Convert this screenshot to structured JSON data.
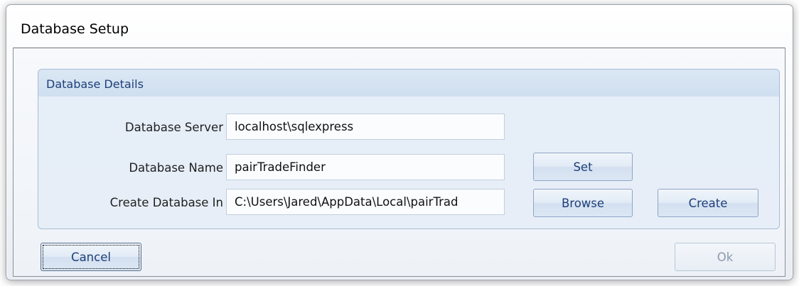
{
  "window": {
    "title": "Database Setup"
  },
  "details": {
    "group_title": "Database Details",
    "server_label": "Database Server",
    "server_value": "localhost\\sqlexpress",
    "name_label": "Database Name",
    "name_value": "pairTradeFinder",
    "location_label": "Create Database In",
    "location_value": "C:\\Users\\Jared\\AppData\\Local\\pairTrad"
  },
  "buttons": {
    "set": "Set",
    "browse": "Browse",
    "create": "Create",
    "cancel": "Cancel",
    "ok": "Ok"
  },
  "colors": {
    "accent_text": "#1e3f78",
    "group_background": "#e6eef8",
    "disabled_text": "#8c9aab"
  }
}
